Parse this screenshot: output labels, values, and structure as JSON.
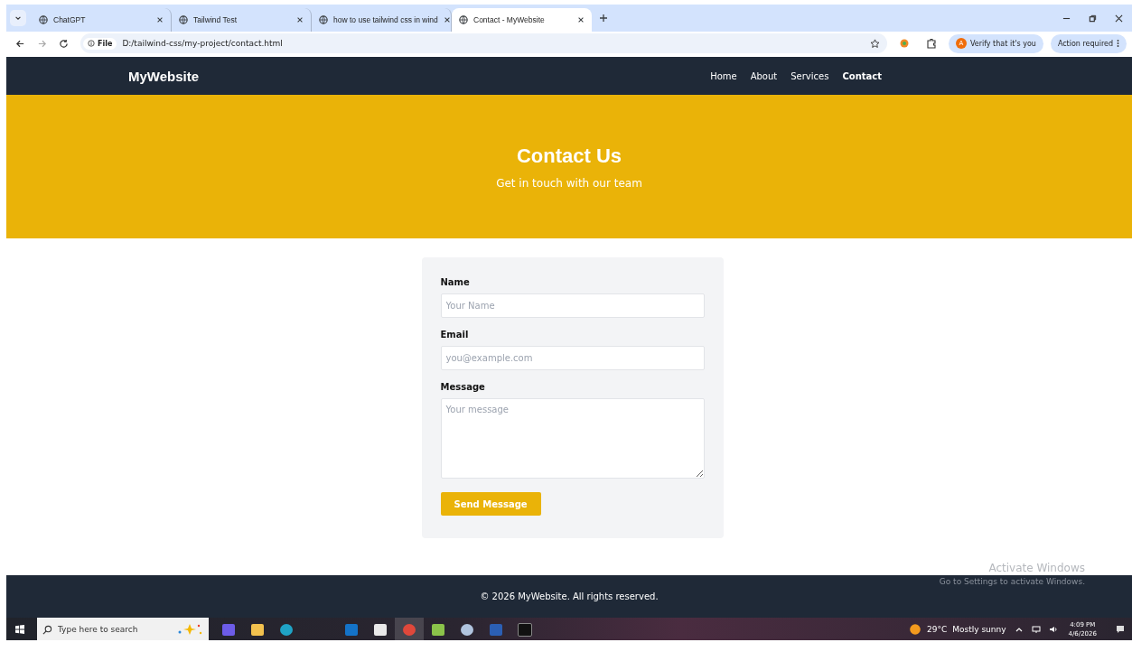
{
  "browser": {
    "tabs": [
      {
        "title": "ChatGPT",
        "selected": false
      },
      {
        "title": "Tailwind Test",
        "selected": false
      },
      {
        "title": "how to use tailwind css in wind",
        "selected": false
      },
      {
        "title": "Contact - MyWebsite",
        "selected": true
      }
    ],
    "file_label": "File",
    "url": "D:/tailwind-css/my-project/contact.html",
    "profile_initial": "A",
    "verify": "Verify that it's you",
    "action": "Action required"
  },
  "site": {
    "logo": "MyWebsite",
    "nav": [
      {
        "label": "Home",
        "selected": false
      },
      {
        "label": "About",
        "selected": false
      },
      {
        "label": "Services",
        "selected": false
      },
      {
        "label": "Contact",
        "selected": true
      }
    ]
  },
  "hero": {
    "title": "Contact Us",
    "subtitle": "Get in touch with our team"
  },
  "form": {
    "fields": [
      {
        "kind": "input",
        "label": "Name",
        "placeholder": "Your Name"
      },
      {
        "kind": "input",
        "label": "Email",
        "placeholder": "you@example.com"
      },
      {
        "kind": "textarea",
        "label": "Message",
        "placeholder": "Your message"
      }
    ],
    "submit": "Send Message"
  },
  "footer": {
    "text": "© 2026 MyWebsite. All rights reserved."
  },
  "activation": {
    "title": "Activate Windows",
    "hint": "Go to Settings to activate Windows."
  },
  "taskbar": {
    "search_placeholder": "Type here to search",
    "weather": "29°C",
    "weather_text": "Mostly sunny",
    "time": "4:09 PM",
    "date": "4/6/2026"
  }
}
